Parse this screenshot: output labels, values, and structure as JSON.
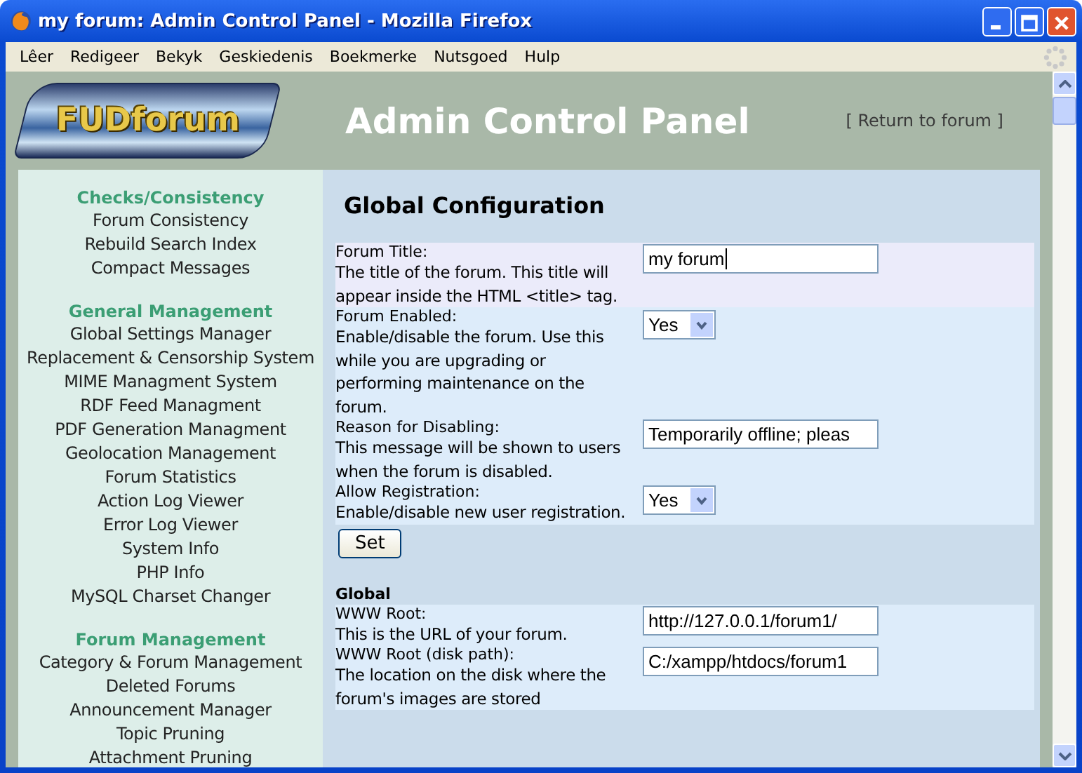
{
  "window": {
    "title": "my forum: Admin Control Panel - Mozilla Firefox"
  },
  "menu": [
    "Lêer",
    "Redigeer",
    "Bekyk",
    "Geskiedenis",
    "Boekmerke",
    "Nutsgoed",
    "Hulp"
  ],
  "header": {
    "logo": "FUDforum",
    "title": "Admin Control Panel",
    "return_link": "[ Return to forum ]"
  },
  "sidebar": {
    "sections": [
      {
        "heading": "Checks/Consistency",
        "items": [
          "Forum Consistency",
          "Rebuild Search Index",
          "Compact Messages"
        ]
      },
      {
        "heading": "General Management",
        "items": [
          "Global Settings Manager",
          "Replacement & Censorship System",
          "MIME Managment System",
          "RDF Feed Managment",
          "PDF Generation Managment",
          "Geolocation Management",
          "Forum Statistics",
          "Action Log Viewer",
          "Error Log Viewer",
          "System Info",
          "PHP Info",
          "MySQL Charset Changer"
        ]
      },
      {
        "heading": "Forum Management",
        "items": [
          "Category & Forum Management",
          "Deleted Forums",
          "Announcement Manager",
          "Topic Pruning",
          "Attachment Pruning"
        ]
      }
    ]
  },
  "main": {
    "heading": "Global Configuration",
    "groups": [
      {
        "rows": [
          {
            "kind": "text",
            "label": "Forum Title:",
            "description": "The title of the forum. This title will appear inside the HTML <title> tag.",
            "value": "my forum",
            "focused": true
          },
          {
            "kind": "select",
            "label": "Forum Enabled:",
            "description": "Enable/disable the forum. Use this while you are upgrading or performing maintenance on the forum.",
            "value": "Yes",
            "focused": false
          },
          {
            "kind": "text",
            "label": "Reason for Disabling:",
            "description": "This message will be shown to users when the forum is disabled.",
            "value": "Temporarily offline; pleas",
            "focused": false
          },
          {
            "kind": "select",
            "label": "Allow Registration:",
            "description": "Enable/disable new user registration.",
            "value": "Yes",
            "focused": false
          }
        ],
        "button": "Set"
      },
      {
        "heading": "Global",
        "rows": [
          {
            "kind": "text",
            "label": "WWW Root:",
            "description": "This is the URL of your forum.",
            "value": "http://127.0.0.1/forum1/",
            "focused": false
          },
          {
            "kind": "text",
            "label": "WWW Root (disk path):",
            "description": "The location on the disk where the forum's images are stored",
            "value": "C:/xampp/htdocs/forum1",
            "focused": false
          }
        ]
      }
    ]
  }
}
